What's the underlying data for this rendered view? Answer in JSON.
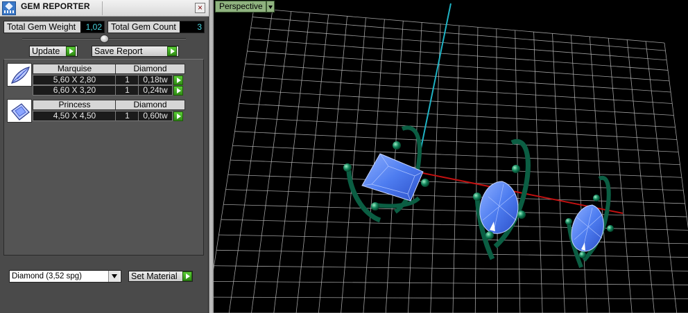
{
  "window": {
    "title": "GEM REPORTER",
    "close_glyph": "×"
  },
  "stats": {
    "weight_label": "Total Gem Weight",
    "weight_value": "1,02",
    "count_label": "Total Gem Count",
    "count_value": "3"
  },
  "slider": {
    "level": 0.5
  },
  "toolbar": {
    "update_label": "Update",
    "save_report_label": "Save Report"
  },
  "gems": [
    {
      "shape": "Marquise",
      "material": "Diamond",
      "icon": "marquise-gem-icon",
      "rows": [
        {
          "size": "5,60 X 2,80",
          "qty": "1",
          "weight": "0,18tw"
        },
        {
          "size": "6,60 X 3,20",
          "qty": "1",
          "weight": "0,24tw"
        }
      ]
    },
    {
      "shape": "Princess",
      "material": "Diamond",
      "icon": "princess-gem-icon",
      "rows": [
        {
          "size": "4,50 X 4,50",
          "qty": "1",
          "weight": "0,60tw"
        }
      ]
    }
  ],
  "material_select": {
    "selected": "Diamond      (3,52 spg)"
  },
  "set_material_label": "Set Material",
  "viewport": {
    "view_label": "Perspective"
  },
  "colors": {
    "panel_bg": "#4a4a4a",
    "accent_value": "#4ad6e0",
    "go_green": "#3aa31a",
    "grid_line": "#bdbdbd",
    "axis_y": "#1fb3c4",
    "axis_x": "#c21010",
    "metal": "#0d5f45",
    "gem": "#4e7df0",
    "view_label_bg": "#8fb27f"
  }
}
